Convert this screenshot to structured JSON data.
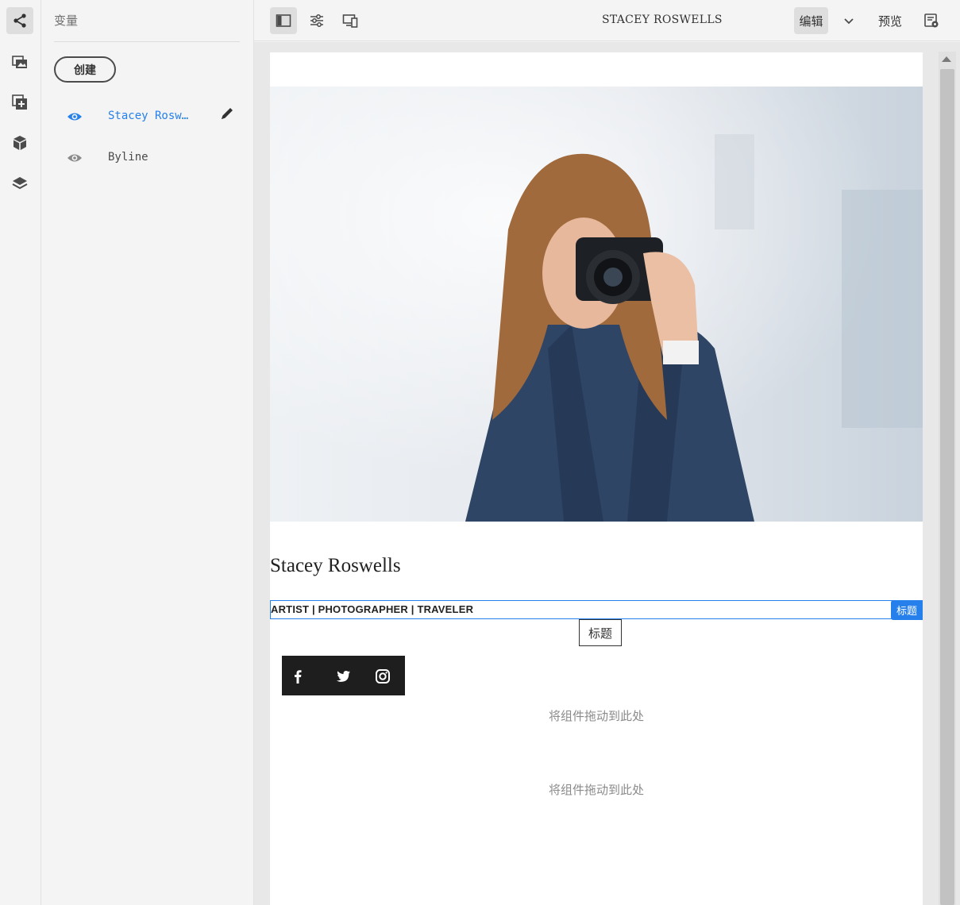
{
  "rail": {
    "items": [
      {
        "icon": "share-nodes-icon",
        "active": true
      },
      {
        "icon": "media-library-icon",
        "active": false
      },
      {
        "icon": "add-component-icon",
        "active": false
      },
      {
        "icon": "cube-icon",
        "active": false
      },
      {
        "icon": "layers-icon",
        "active": false
      }
    ]
  },
  "panel": {
    "title": "变量",
    "create_label": "创建",
    "variations": [
      {
        "label": "Stacey Rosw…",
        "selected": true
      },
      {
        "label": "Byline",
        "selected": false
      }
    ]
  },
  "toolbar": {
    "page_name": "STACEY ROSWELLS",
    "edit_label": "编辑",
    "preview_label": "预览",
    "icons": [
      "side-panel-toggle-icon",
      "properties-icon",
      "emulator-icon",
      "chevron-down-icon",
      "page-info-icon"
    ]
  },
  "content": {
    "name": "Stacey Roswells",
    "subtitle": "ARTIST | PHOTOGRAPHER | TRAVELER",
    "component_badge": "标题",
    "tooltip": "标题",
    "dropzone_1": "将组件拖动到此处",
    "dropzone_2": "将组件拖动到此处",
    "hero_alt": "woman-with-camera-photo",
    "social_icons": [
      "facebook-icon",
      "twitter-icon",
      "instagram-icon"
    ]
  },
  "colors": {
    "accent": "#2680eb",
    "panel_bg": "#f4f4f4",
    "social_bg": "#1e1e1e"
  }
}
